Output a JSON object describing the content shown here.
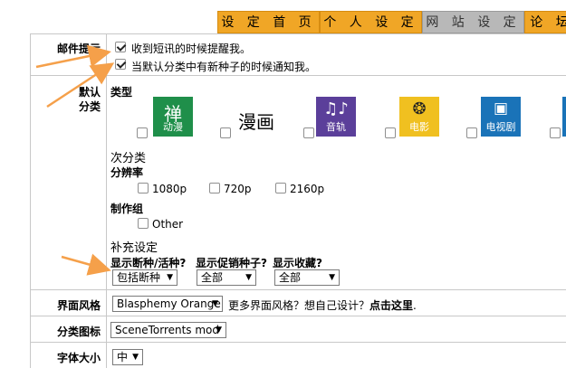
{
  "tabs": [
    "设 定 首 页",
    "个 人 设 定",
    "网 站 设 定",
    "论 坛"
  ],
  "email": {
    "label": "邮件提示",
    "opt1": "收到短讯的时候提醒我。",
    "opt2": "当默认分类中有新种子的时候通知我。"
  },
  "default_category": {
    "label_line1": "默认",
    "label_line2": "分类",
    "type_header": "类型",
    "categories": [
      "动漫",
      "漫画",
      "音轨",
      "电影",
      "电视剧"
    ],
    "category_glyphs": [
      "禅",
      "漫画",
      "♫",
      "film-reel-icon",
      "tv-icon"
    ],
    "subcategory_header": "次分类",
    "resolution_header": "分辨率",
    "resolutions": [
      "1080p",
      "720p",
      "2160p"
    ],
    "group_header": "制作组",
    "groups": [
      "Other"
    ],
    "extra_header": "补充设定",
    "filters": [
      {
        "label": "显示断种/活种?",
        "value": "包括断种"
      },
      {
        "label": "显示促销种子?",
        "value": "全部"
      },
      {
        "label": "显示收藏?",
        "value": "全部"
      }
    ]
  },
  "theme": {
    "label": "界面风格",
    "value": "Blasphemy Orange",
    "more_text": "更多界面风格？想自己设计？",
    "link_text": "点击这里",
    "suffix": "."
  },
  "category_icons": {
    "label": "分类图标",
    "value": "SceneTorrents mod"
  },
  "font_size": {
    "label": "字体大小",
    "value": "中"
  },
  "colors": {
    "tab_orange": "#f0a626",
    "tab_active": "#b8b8b8",
    "arrow_orange": "#f5a04a",
    "anime_green": "#1f8f4a",
    "music_purple": "#5b3f9a",
    "movie_yellow": "#f0c020",
    "tv_blue": "#1a73b8"
  }
}
